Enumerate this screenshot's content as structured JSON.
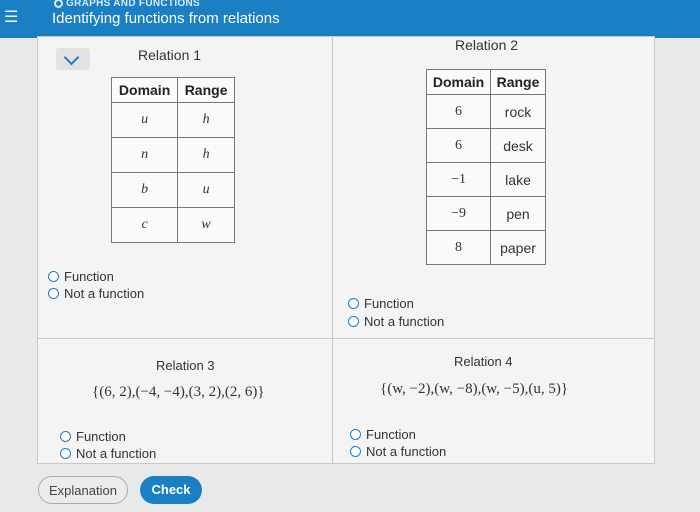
{
  "header": {
    "topic": "GRAPHS AND FUNCTIONS",
    "title": "Identifying functions from relations"
  },
  "relation1": {
    "title": "Relation 1",
    "headers": [
      "Domain",
      "Range"
    ],
    "rows": [
      [
        "u",
        "h"
      ],
      [
        "n",
        "h"
      ],
      [
        "b",
        "u"
      ],
      [
        "c",
        "w"
      ]
    ],
    "options": [
      "Function",
      "Not a function"
    ]
  },
  "relation2": {
    "title": "Relation 2",
    "headers": [
      "Domain",
      "Range"
    ],
    "rows": [
      [
        "6",
        "rock"
      ],
      [
        "6",
        "desk"
      ],
      [
        "−1",
        "lake"
      ],
      [
        "−9",
        "pen"
      ],
      [
        "8",
        "paper"
      ]
    ],
    "options": [
      "Function",
      "Not a function"
    ]
  },
  "relation3": {
    "title": "Relation 3",
    "set": "{(6, 2),(−4, −4),(3, 2),(2, 6)}",
    "options": [
      "Function",
      "Not a function"
    ]
  },
  "relation4": {
    "title": "Relation 4",
    "set": "{(w, −2),(w, −8),(w, −5),(u, 5)}",
    "options": [
      "Function",
      "Not a function"
    ]
  },
  "footer": {
    "explanation_label": "Explanation",
    "check_label": "Check"
  },
  "colors": {
    "accent": "#1b7fc4"
  }
}
